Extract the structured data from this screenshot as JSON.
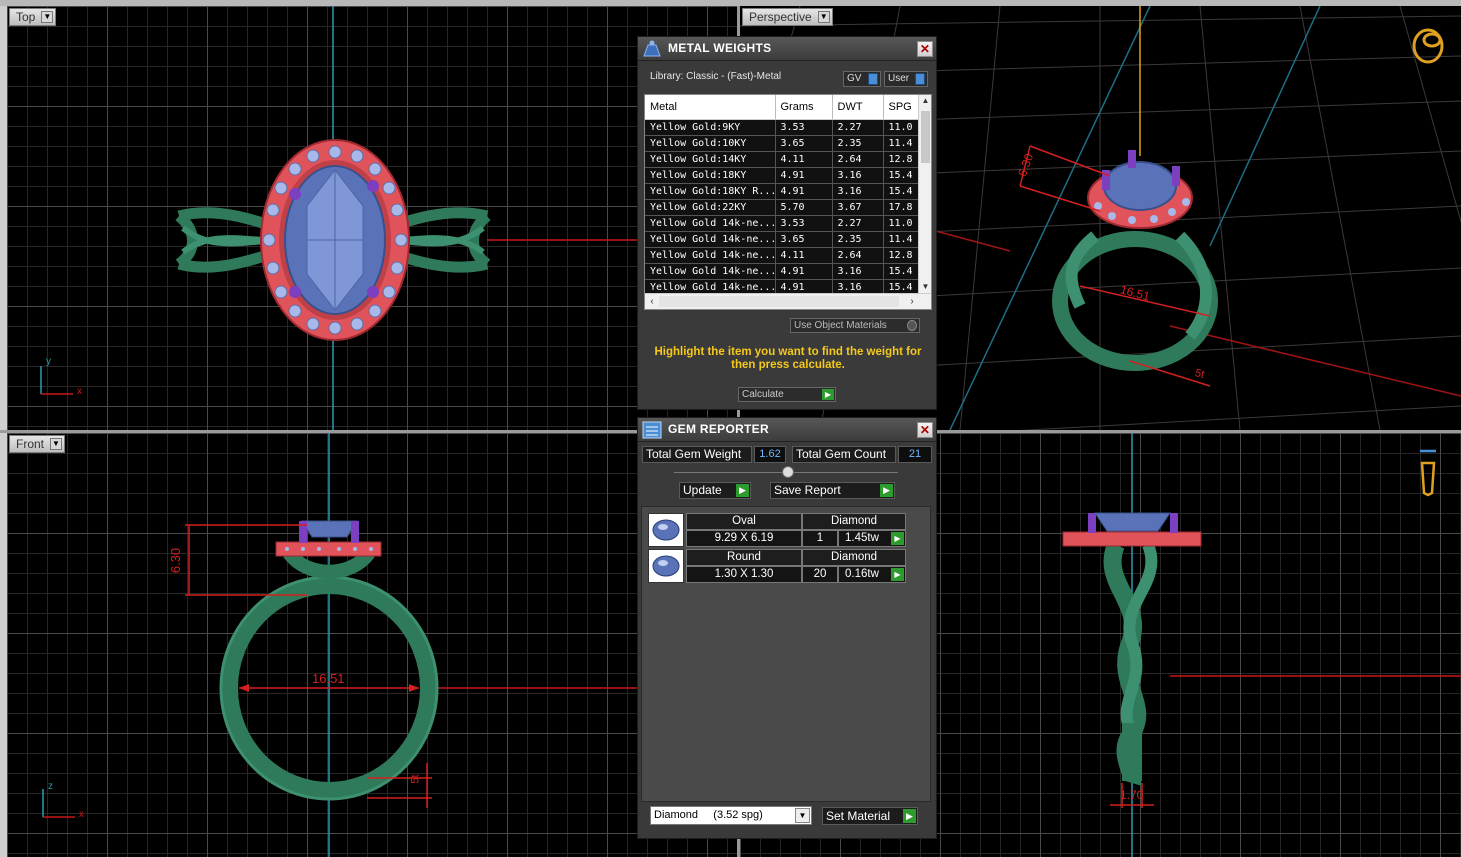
{
  "viewports": {
    "top": {
      "label": "Top",
      "axis_a": "y",
      "axis_b": "x"
    },
    "perspective": {
      "label": "Perspective"
    },
    "front": {
      "label": "Front",
      "axis_a": "z",
      "axis_b": "x",
      "dim_height": "6.30",
      "dim_width": "16.51",
      "dim_band": "5t"
    },
    "right": {
      "dim_band": "1.70"
    },
    "persp_dims": {
      "height": "6.30",
      "width": "16.51",
      "band": "5t"
    }
  },
  "metal_weights": {
    "title": "METAL WEIGHTS",
    "library": "Library: Classic - (Fast)-Metal",
    "gv_label": "GV",
    "user_label": "User",
    "columns": [
      "Metal",
      "Grams",
      "DWT",
      "SPG"
    ],
    "rows": [
      [
        "Yellow Gold:9KY",
        "3.53",
        "2.27",
        "11.0"
      ],
      [
        "Yellow Gold:10KY",
        "3.65",
        "2.35",
        "11.4"
      ],
      [
        "Yellow Gold:14KY",
        "4.11",
        "2.64",
        "12.8"
      ],
      [
        "Yellow Gold:18KY",
        "4.91",
        "3.16",
        "15.4"
      ],
      [
        "Yellow Gold:18KY R...",
        "4.91",
        "3.16",
        "15.4"
      ],
      [
        "Yellow Gold:22KY",
        "5.70",
        "3.67",
        "17.8"
      ],
      [
        "Yellow Gold 14k-ne...",
        "3.53",
        "2.27",
        "11.0"
      ],
      [
        "Yellow Gold 14k-ne...",
        "3.65",
        "2.35",
        "11.4"
      ],
      [
        "Yellow Gold 14k-ne...",
        "4.11",
        "2.64",
        "12.8"
      ],
      [
        "Yellow Gold 14k-ne...",
        "4.91",
        "3.16",
        "15.4"
      ],
      [
        "Yellow Gold 14k-ne...",
        "4.91",
        "3.16",
        "15.4"
      ]
    ],
    "use_object_materials": "Use Object Materials",
    "hint": "Highlight the item you want to find the weight for then press calculate.",
    "calculate_label": "Calculate"
  },
  "gem_reporter": {
    "title": "GEM REPORTER",
    "total_weight_label": "Total Gem Weight",
    "total_weight_value": "1.62",
    "total_count_label": "Total Gem Count",
    "total_count_value": "21",
    "update_label": "Update",
    "save_report_label": "Save Report",
    "gems": [
      {
        "shape": "Oval",
        "material": "Diamond",
        "size": "9.29 X 6.19",
        "count": "1",
        "weight": "1.45tw"
      },
      {
        "shape": "Round",
        "material": "Diamond",
        "size": "1.30 X 1.30",
        "count": "20",
        "weight": "0.16tw"
      }
    ],
    "material_select": "Diamond     (3.52 spg)",
    "set_material_label": "Set Material"
  },
  "colors": {
    "metal": "#2e7a5a",
    "halo": "#e0535a",
    "center_stone": "#5a73b8",
    "prong": "#7b3fc0",
    "dimension": "#d42020",
    "accent_yellow": "#f4c81c",
    "axis_line": "#2a9ab0"
  }
}
